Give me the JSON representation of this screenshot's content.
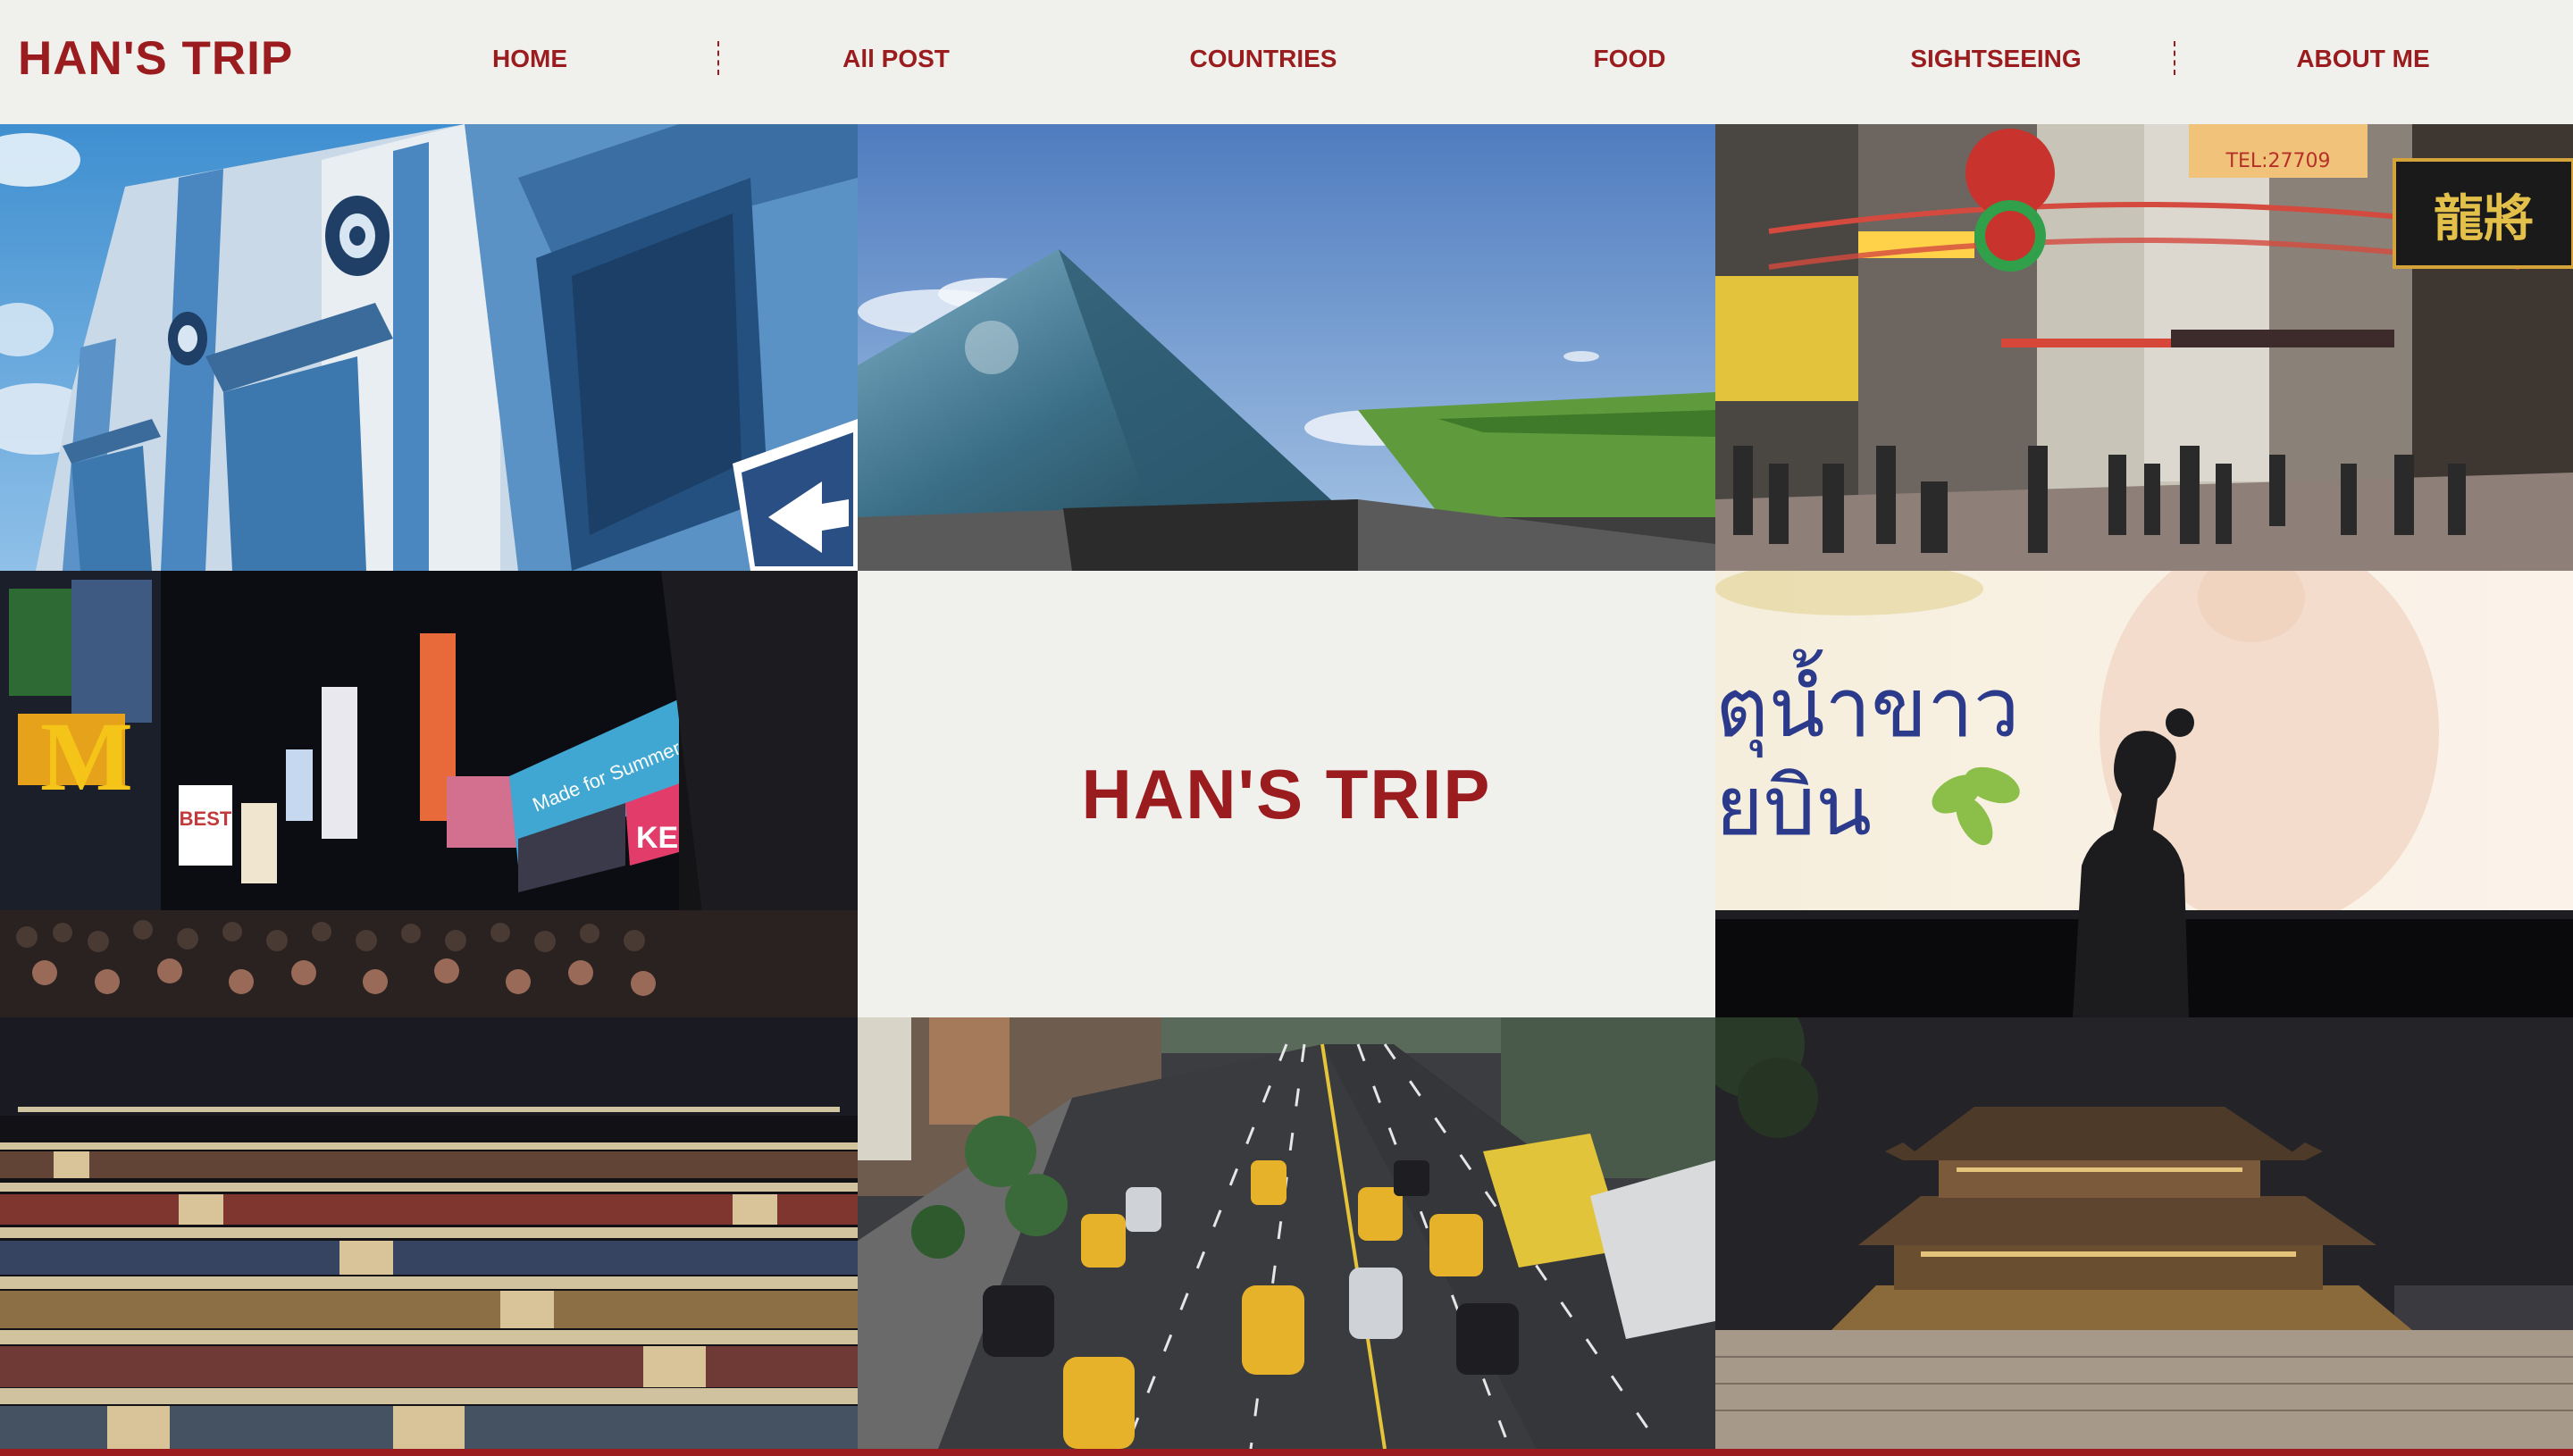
{
  "site": {
    "logo_text": "HAN'S TRIP",
    "center_title": "HAN'S TRIP",
    "brand_color": "#9b1c1f",
    "background_color": "#f0f0ec"
  },
  "nav": {
    "items": [
      {
        "label": "HOME"
      },
      {
        "label": "All POST"
      },
      {
        "label": "COUNTRIES"
      },
      {
        "label": "FOOD"
      },
      {
        "label": "SIGHTSEEING"
      },
      {
        "label": "ABOUT ME"
      }
    ]
  },
  "gallery": {
    "photos": [
      {
        "name": "blue-building-photo"
      },
      {
        "name": "glass-pyramid-photo"
      },
      {
        "name": "hong-kong-street-photo"
      },
      {
        "name": "times-square-photo"
      },
      {
        "name": "billboard-silhouette-photo"
      },
      {
        "name": "night-market-photo"
      },
      {
        "name": "city-traffic-photo"
      },
      {
        "name": "palace-gate-photo"
      }
    ],
    "billboard": {
      "mcdonalds_sign": "M",
      "best_sign": "BEST",
      "keep_sign": "KEEP",
      "k_sign": "K",
      "summer_banner": "Made for Summer.",
      "thai_line_1": "ตุน้ำขาว",
      "thai_line_2": "ยบิน",
      "hk_sign_1": "龍將",
      "hk_sign_2": "TEL:27709"
    }
  }
}
